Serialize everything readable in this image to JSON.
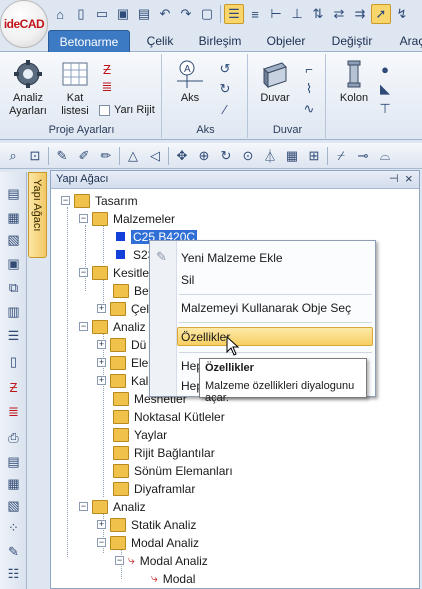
{
  "logo": {
    "text": "ideCAD"
  },
  "tabs": [
    "Betonarme",
    "Çelik",
    "Birleşim",
    "Objeler",
    "Değiştir",
    "Araç"
  ],
  "ribbon": {
    "proje_group": "Proje Ayarları",
    "aks_group": "Aks",
    "duvar_group": "Duvar",
    "analiz_label_1": "Analiz",
    "analiz_label_2": "Ayarları",
    "kat_label_1": "Kat",
    "kat_label_2": "listesi",
    "yari_rijit": "Yarı Rijit",
    "aks_label": "Aks",
    "duvar_label": "Duvar",
    "kolon_label": "Kolon"
  },
  "panel": {
    "title": "Yapı Ağacı",
    "vertical_tab": "Yapı Ağacı",
    "pin": "ᵖ",
    "close": "×"
  },
  "tree": {
    "tasarim": "Tasarım",
    "malzemeler": "Malzemeler",
    "c25": "C25 B420C",
    "s23": "S23",
    "kesitle": "Kesitle",
    "bet": "Bet",
    "cel": "Çel",
    "analiz1": "Analiz",
    "du": "Dü",
    "ele": "Ele",
    "kal": "Kal",
    "mesnetler": "Mesnetler",
    "noktasal": "Noktasal Kütleler",
    "yaylar": "Yaylar",
    "rijit": "Rijit Bağlantılar",
    "sonum": "Sönüm Elemanları",
    "diyaframlar": "Diyaframlar",
    "analiz2": "Analiz",
    "statik": "Statik Analiz",
    "modal": "Modal Analiz",
    "modal_sub": "Modal Analiz",
    "modal_leaf": "Modal"
  },
  "context_menu": {
    "yeni": "Yeni Malzeme Ekle",
    "sil": "Sil",
    "kullanarak": "Malzemeyi Kullanarak Obje Seç",
    "ozellikler": "Özellikler",
    "hep1": "Hep",
    "hep2": "Hep"
  },
  "tooltip": {
    "title": "Özellikler",
    "desc": "Malzeme özellikleri diyalogunu açar."
  },
  "colors": {
    "active_tab": "#3d7ac4",
    "selection": "#2f6fd6",
    "highlight": "#f7cf63",
    "material_square": "#1340d8"
  }
}
